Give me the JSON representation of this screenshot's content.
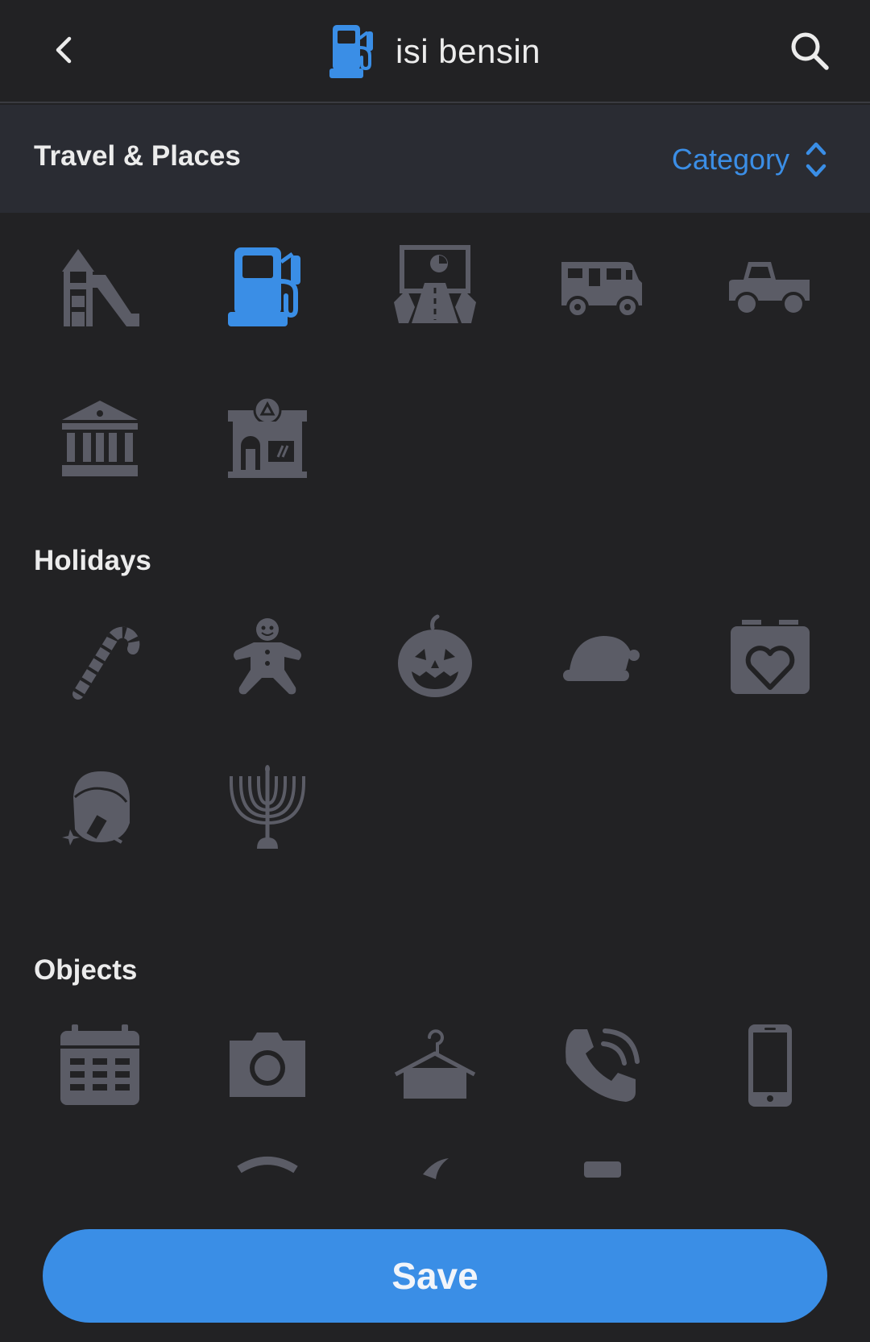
{
  "header": {
    "title": "isi bensin",
    "icon": "gas-pump-icon",
    "back_icon": "chevron-left-icon",
    "search_icon": "search-icon"
  },
  "category_bar": {
    "current_section": "Travel & Places",
    "category_label": "Category",
    "category_icon": "sort-arrows-icon"
  },
  "sections": [
    {
      "title": "Travel & Places",
      "icons": [
        "playground-icon",
        "gas-pump-icon",
        "road-map-icon",
        "camper-van-icon",
        "pickup-truck-icon",
        "bank-building-icon",
        "store-icon"
      ]
    },
    {
      "title": "Holidays",
      "icons": [
        "candy-cane-icon",
        "gingerbread-man-icon",
        "jack-o-lantern-icon",
        "santa-hat-icon",
        "calendar-heart-icon",
        "face-shaving-icon",
        "menorah-icon"
      ]
    },
    {
      "title": "Objects",
      "icons": [
        "calendar-icon",
        "camera-icon",
        "hanger-icon",
        "phone-ringing-icon",
        "mobile-phone-icon"
      ]
    }
  ],
  "selected_icon": "gas-pump-icon",
  "save_label": "Save",
  "colors": {
    "background": "#222224",
    "category_bar": "#2a2c33",
    "accent": "#3a8ee6",
    "icon_default": "#5b5c66",
    "text": "#ececec"
  }
}
